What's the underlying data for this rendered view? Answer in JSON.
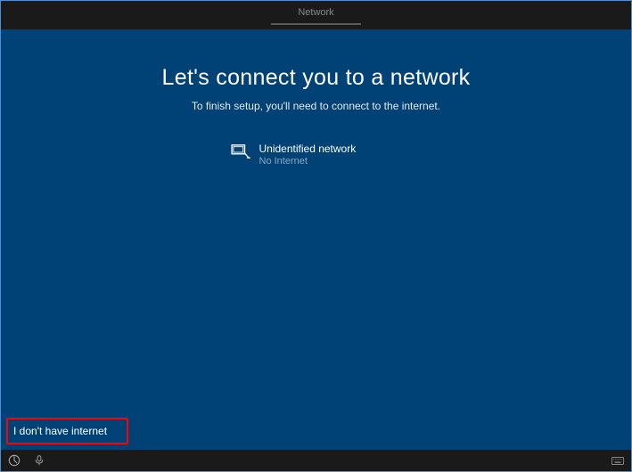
{
  "header": {
    "tab_label": "Network"
  },
  "main": {
    "title": "Let's connect you to a network",
    "subtitle": "To finish setup, you'll need to connect to the internet."
  },
  "networks": [
    {
      "name": "Unidentified network",
      "status": "No Internet"
    }
  ],
  "actions": {
    "skip_label": "I don't have internet"
  }
}
